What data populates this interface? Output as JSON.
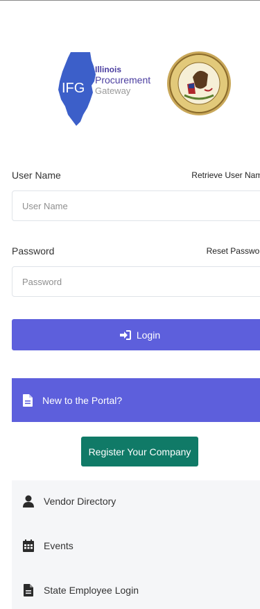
{
  "logo": {
    "line1": "Illinois",
    "line2": "Procurement",
    "line3": "Gateway",
    "monogram": "IFG",
    "seal_text": "SEAL OF THE STATE OF ILLINOIS AUG. 26TH 1818"
  },
  "username": {
    "label": "User Name",
    "link": "Retrieve User Name",
    "placeholder": "User Name",
    "value": ""
  },
  "password": {
    "label": "Password",
    "link": "Reset Password",
    "placeholder": "Password",
    "value": ""
  },
  "login": {
    "label": "Login",
    "icon": "sign-in-icon"
  },
  "portal": {
    "header": "New to the Portal?",
    "header_icon": "file-icon",
    "register_label": "Register Your Company",
    "items": [
      {
        "label": "Vendor Directory",
        "icon": "user-icon"
      },
      {
        "label": "Events",
        "icon": "calendar-icon"
      },
      {
        "label": "State Employee Login",
        "icon": "file-icon"
      }
    ]
  },
  "colors": {
    "primary": "#5d5fdc",
    "register": "#107a67",
    "panel_bg": "#f5f6f8"
  }
}
